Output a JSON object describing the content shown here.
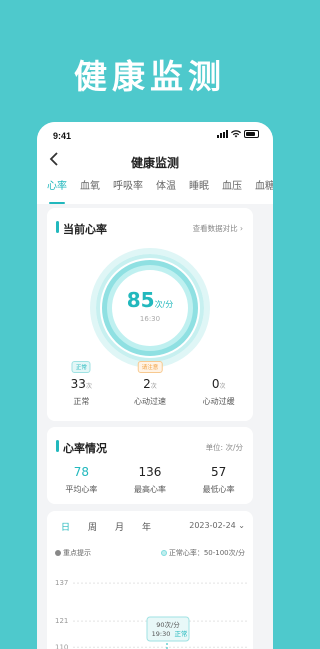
{
  "banner": {
    "title": "健康监测"
  },
  "status_bar": {
    "time": "9:41"
  },
  "nav": {
    "back_icon": "chevron-left-icon",
    "title": "健康监测"
  },
  "tabs": [
    {
      "label": "心率",
      "active": true
    },
    {
      "label": "血氧",
      "active": false
    },
    {
      "label": "呼吸率",
      "active": false
    },
    {
      "label": "体温",
      "active": false
    },
    {
      "label": "睡眠",
      "active": false
    },
    {
      "label": "血压",
      "active": false
    },
    {
      "label": "血糖",
      "active": false
    }
  ],
  "current_hr": {
    "title": "当前心率",
    "compare_link": "查看数据对比",
    "value": "85",
    "unit": "次/分",
    "time": "16:30",
    "stats": [
      {
        "badge": "正常",
        "value": "33",
        "unit": "次",
        "label": "正常"
      },
      {
        "badge": "请注意",
        "value": "2",
        "unit": "次",
        "label": "心动过速"
      },
      {
        "badge": "",
        "value": "0",
        "unit": "次",
        "label": "心动过缓"
      }
    ]
  },
  "hr_summary": {
    "title": "心率情况",
    "unit_label": "单位: 次/分",
    "items": [
      {
        "value": "78",
        "label": "平均心率"
      },
      {
        "value": "136",
        "label": "最高心率"
      },
      {
        "value": "57",
        "label": "最低心率"
      }
    ]
  },
  "trend": {
    "periods": [
      {
        "label": "日",
        "active": true
      },
      {
        "label": "周",
        "active": false
      },
      {
        "label": "月",
        "active": false
      },
      {
        "label": "年",
        "active": false
      }
    ],
    "date": "2023-02-24",
    "hint": "重点提示",
    "normal_range": "正常心率：50-100次/分",
    "tooltip": {
      "value": "90次/分",
      "time": "19:30",
      "status": "正常"
    }
  },
  "chart_data": {
    "type": "line",
    "y_ticks": [
      137,
      121,
      110
    ],
    "ylim": [
      100,
      140
    ],
    "normal_band": [
      50,
      100
    ]
  }
}
